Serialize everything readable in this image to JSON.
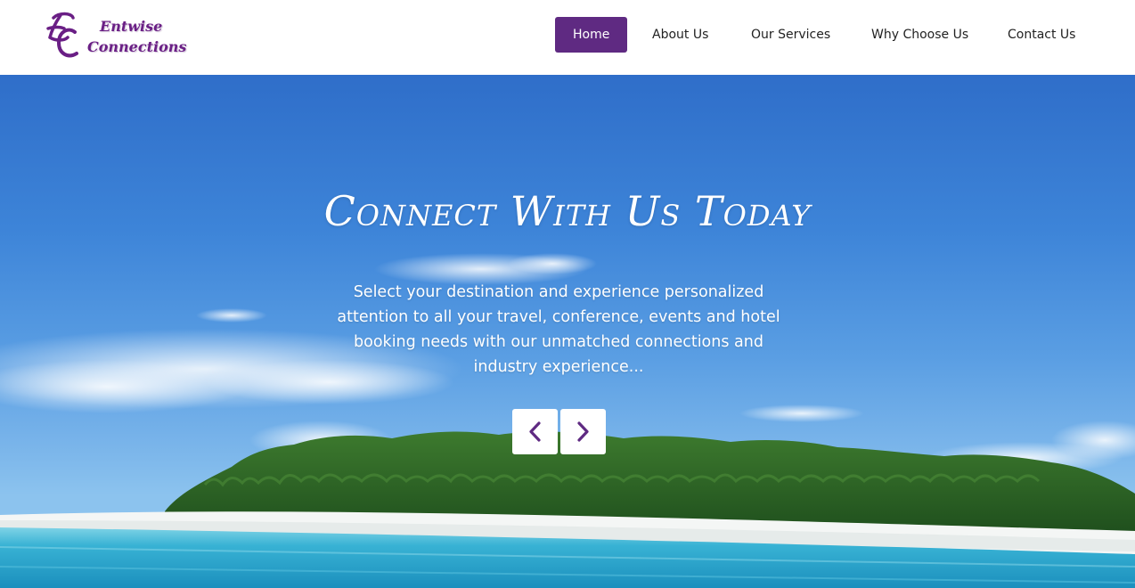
{
  "logo": {
    "line1": "Entwise",
    "line2": "Connections"
  },
  "nav": {
    "items": [
      {
        "label": "Home",
        "active": true
      },
      {
        "label": "About Us",
        "active": false
      },
      {
        "label": "Our Services",
        "active": false
      },
      {
        "label": "Why Choose Us",
        "active": false
      },
      {
        "label": "Contact Us",
        "active": false
      }
    ]
  },
  "hero": {
    "title": "Connect With Us Today",
    "text": "Select your destination and experience personalized attention to all your travel, conference, events and hotel booking needs with our unmatched connections and industry experience...",
    "prev_icon": "chevron-left-icon",
    "next_icon": "chevron-right-icon"
  },
  "colors": {
    "brand": "#5f2a82",
    "logo": "#6a1f85",
    "sky": "#3d84d8",
    "sea": "#2fa3c4"
  }
}
